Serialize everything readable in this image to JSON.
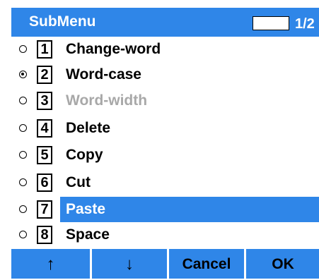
{
  "title": "SubMenu",
  "page_indicator": "1/2",
  "colors": {
    "accent": "#2f86e8",
    "disabled_text": "#a8a8a8"
  },
  "items": [
    {
      "number": "1",
      "label": "Change-word",
      "selected": false,
      "disabled": false,
      "highlighted": false
    },
    {
      "number": "2",
      "label": "Word-case",
      "selected": true,
      "disabled": false,
      "highlighted": false
    },
    {
      "number": "3",
      "label": "Word-width",
      "selected": false,
      "disabled": true,
      "highlighted": false
    },
    {
      "number": "4",
      "label": "Delete",
      "selected": false,
      "disabled": false,
      "highlighted": false
    },
    {
      "number": "5",
      "label": "Copy",
      "selected": false,
      "disabled": false,
      "highlighted": false
    },
    {
      "number": "6",
      "label": "Cut",
      "selected": false,
      "disabled": false,
      "highlighted": false
    },
    {
      "number": "7",
      "label": "Paste",
      "selected": false,
      "disabled": false,
      "highlighted": true
    },
    {
      "number": "8",
      "label": "Space",
      "selected": false,
      "disabled": false,
      "highlighted": false
    }
  ],
  "softkeys": [
    "↑",
    "↓",
    "Cancel",
    "OK"
  ]
}
